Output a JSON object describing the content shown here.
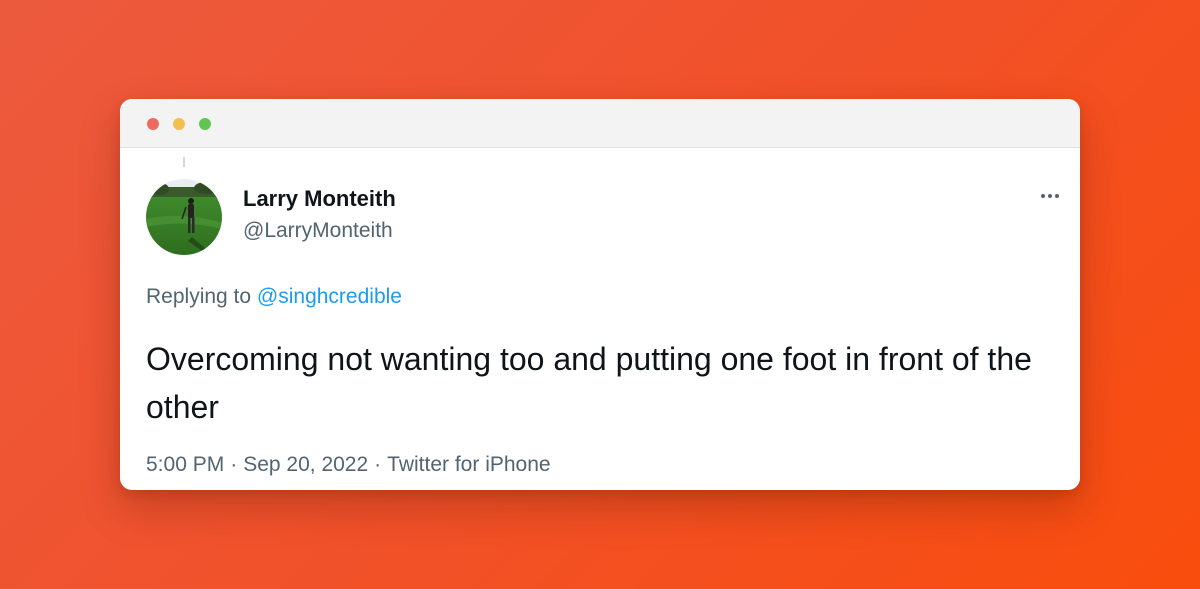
{
  "window": {
    "controls": [
      {
        "name": "close",
        "color": "#ed6a5e"
      },
      {
        "name": "minimize",
        "color": "#f5bf4f"
      },
      {
        "name": "maximize",
        "color": "#61c554"
      }
    ]
  },
  "tweet": {
    "author": {
      "display_name": "Larry Monteith",
      "handle": "@LarryMonteith",
      "avatar_icon": "avatar-photo-golfer-on-grass"
    },
    "more_icon": "more-horizontal-icon",
    "replying_prefix": "Replying to",
    "replying_to": "@singhcredible",
    "text": "Overcoming not wanting too and putting one foot in front of the other",
    "time": "5:00 PM",
    "date": "Sep 20, 2022",
    "source": "Twitter for iPhone",
    "separator": "·"
  },
  "colors": {
    "background_start": "#ec5a3e",
    "background_end": "#f94d0d",
    "link": "#1d9bf0",
    "text_primary": "#0f1419",
    "text_secondary": "#536471"
  }
}
